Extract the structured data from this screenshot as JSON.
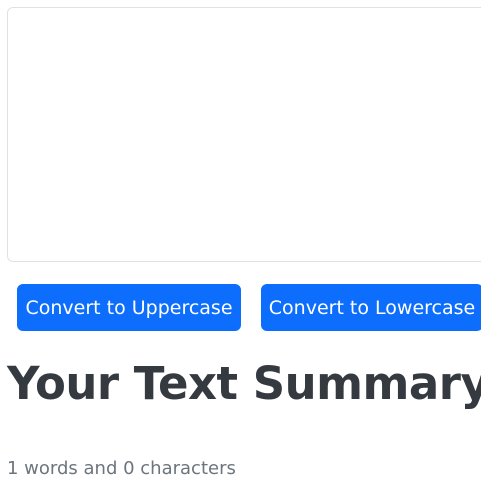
{
  "editor": {
    "value": "",
    "placeholder": ""
  },
  "buttons": {
    "uppercase_label": "Convert to Uppercase",
    "lowercase_label": "Convert to Lowercase"
  },
  "summary": {
    "title": "Your Text Summary",
    "stats": "1 words and 0 characters"
  },
  "colors": {
    "primary": "#0d6efd",
    "heading": "#343a40",
    "muted": "#6c757d",
    "border": "#dee2e6"
  }
}
